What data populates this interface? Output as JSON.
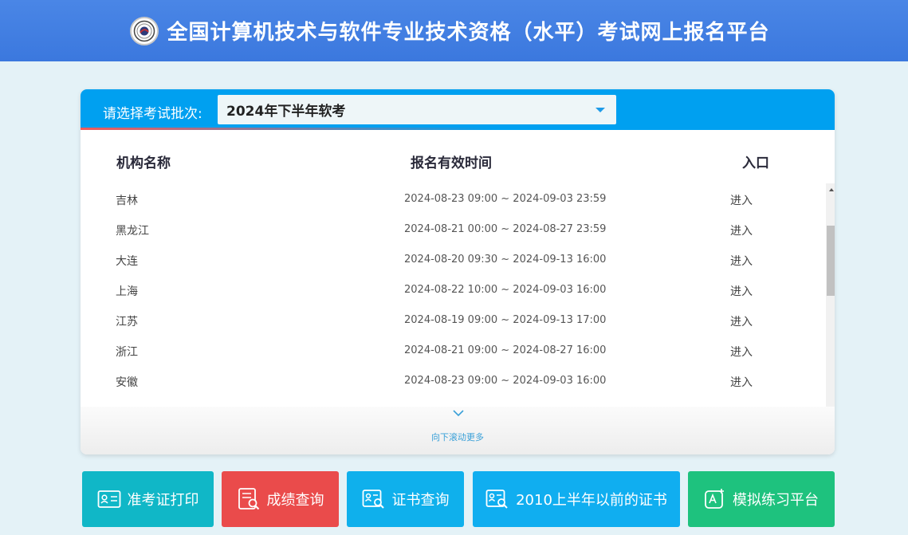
{
  "header": {
    "title": "全国计算机技术与软件专业技术资格（水平）考试网上报名平台",
    "logo_icon": "seal-logo-icon"
  },
  "batch": {
    "label": "请选择考试批次:",
    "selected": "2024年下半年软考"
  },
  "table": {
    "columns": [
      "机构名称",
      "报名有效时间",
      "入口"
    ],
    "rows": [
      {
        "name": "吉林",
        "time": "2024-08-23 09:00 ~ 2024-09-03 23:59",
        "enter": "进入"
      },
      {
        "name": "黑龙江",
        "time": "2024-08-21 00:00 ~ 2024-08-27 23:59",
        "enter": "进入"
      },
      {
        "name": "大连",
        "time": "2024-08-20 09:30 ~ 2024-09-13 16:00",
        "enter": "进入"
      },
      {
        "name": "上海",
        "time": "2024-08-22 10:00 ~ 2024-09-03 16:00",
        "enter": "进入"
      },
      {
        "name": "江苏",
        "time": "2024-08-19 09:00 ~ 2024-09-13 17:00",
        "enter": "进入"
      },
      {
        "name": "浙江",
        "time": "2024-08-21 09:00 ~ 2024-08-27 16:00",
        "enter": "进入"
      },
      {
        "name": "安徽",
        "time": "2024-08-23 09:00 ~ 2024-09-03 16:00",
        "enter": "进入"
      }
    ],
    "scroll_more": "向下滚动更多"
  },
  "buttons": [
    {
      "label": "准考证打印",
      "icon": "id-card-icon",
      "color": "#10b7c7"
    },
    {
      "label": "成绩查询",
      "icon": "document-search-icon",
      "color": "#ea4b4b"
    },
    {
      "label": "证书查询",
      "icon": "certificate-search-icon",
      "color": "#0fb0ec"
    },
    {
      "label": "2010上半年以前的证书",
      "icon": "certificate-search-icon",
      "color": "#10aef0"
    },
    {
      "label": "模拟练习平台",
      "icon": "edit-practice-icon",
      "color": "#1ec27e"
    }
  ],
  "colors": {
    "header": "#3b78de",
    "panel_head": "#00a0f0",
    "background": "#e4f2f7"
  }
}
